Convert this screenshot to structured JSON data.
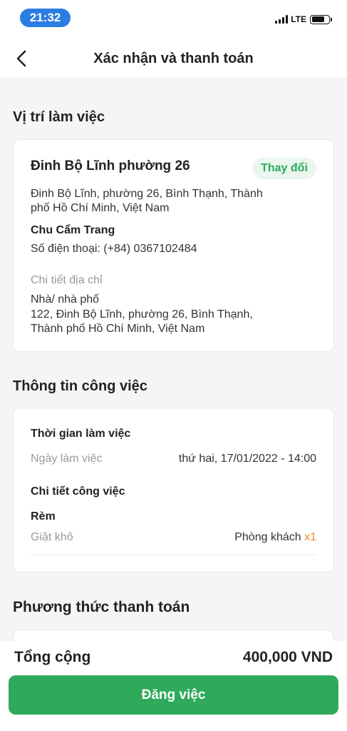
{
  "status_bar": {
    "time": "21:32",
    "network": "LTE"
  },
  "header": {
    "title": "Xác nhận và thanh toán"
  },
  "location": {
    "section_title": "Vị trí làm việc",
    "name": "Đinh Bộ Lĩnh phường 26",
    "change_label": "Thay đổi",
    "address_line1": "Đinh Bộ Lĩnh, phường 26, Bình Thạnh, Thành",
    "address_line2": "phố Hồ Chí Minh, Việt Nam",
    "contact_name": "Chu Cẩm Trang",
    "phone": "Số điện thoại: (+84) 0367102484",
    "detail_label": "Chi tiết địa chỉ",
    "house_type": "Nhà/ nhà phố",
    "detail_line1": "122, Đinh Bộ Lĩnh, phường 26, Bình Thạnh,",
    "detail_line2": "Thành phố Hồ Chí Minh, Việt Nam"
  },
  "job": {
    "section_title": "Thông tin công việc",
    "time_heading": "Thời gian làm việc",
    "date_label": "Ngày làm việc",
    "date_value": "thứ hai, 17/01/2022 - 14:00",
    "detail_heading": "Chi tiết công việc",
    "item_category": "Rèm",
    "item_service": "Giặt khô",
    "item_room": "Phòng khách",
    "item_qty": "x1"
  },
  "payment": {
    "section_title": "Phương thức thanh toán"
  },
  "footer": {
    "total_label": "Tổng cộng",
    "total_value": "400,000 VND",
    "submit_label": "Đăng việc"
  },
  "colors": {
    "primary": "#2eaa5a",
    "accent": "#e58a2e",
    "time_pill": "#2a7de1"
  }
}
